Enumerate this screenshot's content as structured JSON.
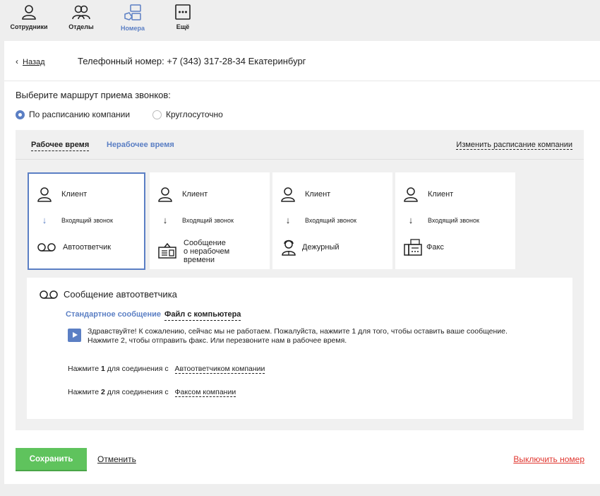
{
  "nav": {
    "items": [
      {
        "label": "Сотрудники",
        "icon": "employees-icon"
      },
      {
        "label": "Отделы",
        "icon": "departments-icon"
      },
      {
        "label": "Номера",
        "icon": "numbers-icon",
        "active": true
      },
      {
        "label": "Ещё",
        "icon": "more-icon"
      }
    ]
  },
  "header": {
    "back_label": "Назад",
    "title": "Телефонный номер: +7 (343) 317-28-34 Екатеринбург"
  },
  "route": {
    "title": "Выберите маршрут приема звонков:",
    "options": [
      {
        "label": "По расписанию компании",
        "checked": true
      },
      {
        "label": "Круглосуточно",
        "checked": false
      }
    ]
  },
  "schedule": {
    "tabs": [
      "Рабочее время",
      "Нерабочее время"
    ],
    "change_link": "Изменить расписание компании",
    "cards": [
      {
        "from": "Клиент",
        "arrow": "Входящий звонок",
        "to": "Автоответчик"
      },
      {
        "from": "Клиент",
        "arrow": "Входящий звонок",
        "to_lines": [
          "Сообщение",
          "о нерабочем",
          "времени"
        ]
      },
      {
        "from": "Клиент",
        "arrow": "Входящий звонок",
        "to": "Дежурный"
      },
      {
        "from": "Клиент",
        "arrow": "Входящий звонок",
        "to": "Факс"
      }
    ]
  },
  "autoresponder": {
    "title": "Сообщение автоответчика",
    "tabs": [
      "Стандартное сообщение",
      "Файл с компьютера"
    ],
    "message_line1": "Здравствуйте! К сожалению, сейчас мы не работаем. Пожалуйста, нажмите 1 для того, чтобы оставить ваше сообщение.",
    "message_line2": "Нажмите 2, чтобы отправить факс. Или перезвоните нам в рабочее время.",
    "press": [
      {
        "prefix": "Нажмите",
        "num": "1",
        "middle": "для соединения с",
        "target": "Автоответчиком компании"
      },
      {
        "prefix": "Нажмите",
        "num": "2",
        "middle": "для соединения с",
        "target": "Факсом компании"
      }
    ]
  },
  "actions": {
    "save": "Сохранить",
    "cancel": "Отменить",
    "disable": "Выключить номер"
  },
  "colors": {
    "accent": "#5b7fc4",
    "save": "#5fc35d",
    "danger": "#e0362f"
  }
}
